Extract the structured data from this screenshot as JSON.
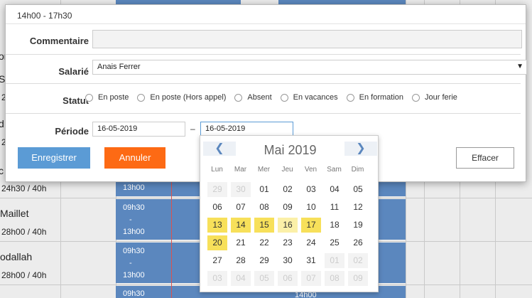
{
  "background": {
    "rows": [
      {
        "name": "or",
        "hours": ""
      },
      {
        "name": "S",
        "hours": "2"
      },
      {
        "name": "d",
        "hours": "2"
      },
      {
        "name": "c",
        "hours": "24h30 / 40h"
      },
      {
        "name": "Maillet",
        "hours": "28h00 / 40h"
      },
      {
        "name": "odallah",
        "hours": "28h00 / 40h"
      }
    ],
    "shifts": [
      {
        "start": "",
        "end": "13h00"
      },
      {
        "start": "09h30",
        "dash": "-",
        "end": "13h00"
      },
      {
        "start": "09h30",
        "dash": "-",
        "end": "13h00"
      },
      {
        "start": "09h30",
        "end": ""
      }
    ],
    "extra_label": "14h00"
  },
  "modal": {
    "title": "14h00 - 17h30",
    "comment_label": "Commentaire",
    "comment_value": "",
    "employee_label": "Salarié",
    "employee_value": "Anais Ferrer",
    "status_label": "Statut",
    "status_options": [
      "En poste",
      "En poste (Hors appel)",
      "Absent",
      "En vacances",
      "En formation",
      "Jour ferie"
    ],
    "period_label": "Période",
    "period_from": "16-05-2019",
    "period_dash": "–",
    "period_to": "16-05-2019",
    "save_label": "Enregistrer",
    "cancel_label": "Annuler",
    "clear_label": "Effacer"
  },
  "datepicker": {
    "month_title": "Mai 2019",
    "prev_label": "❮",
    "next_label": "❯",
    "weekdays": [
      "Lun",
      "Mar",
      "Mer",
      "Jeu",
      "Ven",
      "Sam",
      "Dim"
    ],
    "weeks": [
      [
        "29",
        "30",
        "01",
        "02",
        "03",
        "04",
        "05"
      ],
      [
        "06",
        "07",
        "08",
        "09",
        "10",
        "11",
        "12"
      ],
      [
        "13",
        "14",
        "15",
        "16",
        "17",
        "18",
        "19"
      ],
      [
        "20",
        "21",
        "22",
        "23",
        "24",
        "25",
        "26"
      ],
      [
        "27",
        "28",
        "29",
        "30",
        "31",
        "01",
        "02"
      ],
      [
        "03",
        "04",
        "05",
        "06",
        "07",
        "08",
        "09"
      ]
    ],
    "other_month": [
      [
        0,
        0
      ],
      [
        0,
        1
      ],
      [
        4,
        5
      ],
      [
        4,
        6
      ],
      [
        5,
        0
      ],
      [
        5,
        1
      ],
      [
        5,
        2
      ],
      [
        5,
        3
      ],
      [
        5,
        4
      ],
      [
        5,
        5
      ],
      [
        5,
        6
      ]
    ],
    "highlighted": [
      [
        2,
        0
      ],
      [
        2,
        1
      ],
      [
        2,
        2
      ],
      [
        2,
        4
      ],
      [
        3,
        0
      ]
    ],
    "today": [
      [
        2,
        3
      ]
    ]
  }
}
